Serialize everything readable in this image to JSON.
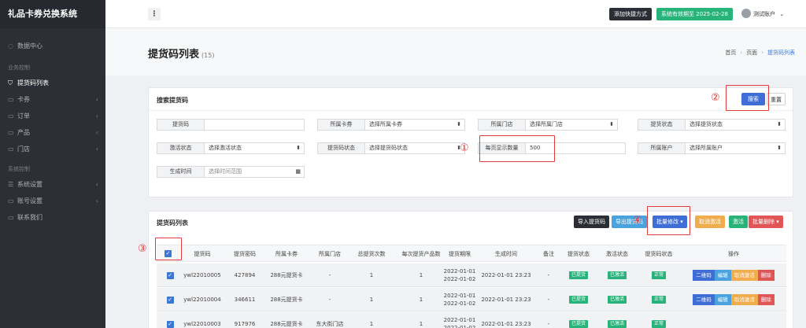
{
  "app": {
    "title": "礼品卡券兑换系统"
  },
  "sidebar": {
    "items": [
      {
        "label": "数据中心",
        "icon": "dashboard-icon"
      },
      {
        "section": "业务控制"
      },
      {
        "label": "提货码列表",
        "icon": "cart-icon",
        "active": true
      },
      {
        "label": "卡券",
        "icon": "card-icon",
        "expand": true
      },
      {
        "label": "订单",
        "icon": "order-icon",
        "expand": true
      },
      {
        "label": "产品",
        "icon": "product-icon",
        "expand": true
      },
      {
        "label": "门店",
        "icon": "store-icon",
        "expand": true
      },
      {
        "section": "系统控制"
      },
      {
        "label": "系统设置",
        "icon": "settings-icon",
        "expand": true
      },
      {
        "label": "账号设置",
        "icon": "account-icon",
        "expand": true
      },
      {
        "label": "联系我们",
        "icon": "contact-icon"
      }
    ]
  },
  "topbar": {
    "menu_label": "⋮",
    "shortcut_label": "添加快捷方式",
    "validity_label": "系统有效期至 2025-02-28",
    "user_label": "测试账户",
    "user_caret": "⌄"
  },
  "page": {
    "title": "提货码列表",
    "count": "(15)",
    "breadcrumb": [
      "首页",
      "页面",
      "提货码列表"
    ]
  },
  "search": {
    "title": "搜索提货码",
    "search_label": "搜索",
    "reset_label": "重置",
    "fields": [
      {
        "label": "提货码",
        "value": "",
        "type": "input"
      },
      {
        "label": "所属卡券",
        "value": "选择所属卡券",
        "type": "select"
      },
      {
        "label": "所属门店",
        "value": "选择所属门店",
        "type": "select"
      },
      {
        "label": "提货状态",
        "value": "选择提货状态",
        "type": "select"
      },
      {
        "label": "激活状态",
        "value": "选择激活状态",
        "type": "select"
      },
      {
        "label": "提货码状态",
        "value": "选择提货码状态",
        "type": "select"
      },
      {
        "label": "每页显示数量",
        "value": "500",
        "type": "input"
      },
      {
        "label": "所属账户",
        "value": "选择所属账户",
        "type": "select"
      },
      {
        "label": "生成时间",
        "value": "选择时间范围",
        "type": "date"
      }
    ]
  },
  "list": {
    "title": "提货码列表",
    "toolbar": [
      {
        "label": "导入提货码",
        "color": "#2b2f35"
      },
      {
        "label": "导出提货码",
        "color": "#4aa3df"
      },
      {
        "label": "批量修改 ▾",
        "color": "#3f6fd6"
      },
      {
        "label": "取消激活",
        "color": "#f0ad4e"
      },
      {
        "label": "激活",
        "color": "#27b37a"
      },
      {
        "label": "批量删除 ▾",
        "color": "#e05555"
      }
    ],
    "columns": [
      "提货码",
      "提货密码",
      "所属卡券",
      "所属门店",
      "总提货次数",
      "每次提货产品数",
      "提货期限",
      "生成时间",
      "备注",
      "提货状态",
      "激活状态",
      "提货码状态",
      "操作"
    ],
    "rows": [
      {
        "code": "ywl22010005",
        "password": "427894",
        "card": "288元提货卡",
        "store": "-",
        "total": "1",
        "per": "1",
        "period_start": "2022-01-01",
        "period_end": "2022-01-02",
        "created": "2022-01-01 23:23",
        "note": "-",
        "pick_status": "已提货",
        "active_status": "已激活",
        "code_status": "正常"
      },
      {
        "code": "ywl22010004",
        "password": "346611",
        "card": "288元提货卡",
        "store": "-",
        "total": "1",
        "per": "1",
        "period_start": "2022-01-01",
        "period_end": "2022-01-02",
        "created": "2022-01-01 23:23",
        "note": "-",
        "pick_status": "已提货",
        "active_status": "已激活",
        "code_status": "正常"
      },
      {
        "code": "ywl22010003",
        "password": "917976",
        "card": "288元提货卡",
        "store": "东大街门店",
        "total": "1",
        "per": "1",
        "period_start": "2022-01-01",
        "period_end": "2022-01-02",
        "created": "2022-01-01 23:23",
        "note": "-",
        "pick_status": "已提货",
        "active_status": "已激活",
        "code_status": "正常"
      }
    ],
    "row_actions": [
      {
        "label": "二维码",
        "color": "#3f6fd6"
      },
      {
        "label": "编辑",
        "color": "#4aa3df"
      },
      {
        "label": "取消激活",
        "color": "#f0ad4e"
      },
      {
        "label": "删除",
        "color": "#e05555"
      }
    ]
  },
  "annotations": [
    "①",
    "②",
    "③",
    "④"
  ]
}
